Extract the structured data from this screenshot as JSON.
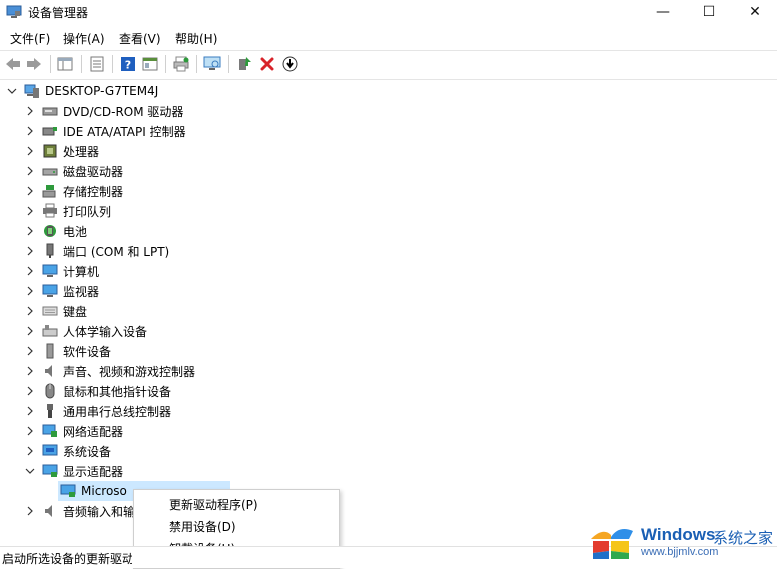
{
  "window": {
    "title": "设备管理器",
    "minimize_glyph": "—",
    "maximize_glyph": "☐",
    "close_glyph": "✕"
  },
  "menu": [
    "文件(F)",
    "操作(A)",
    "查看(V)",
    "帮助(H)"
  ],
  "toolbar": {
    "icons": [
      "back-arrow-icon",
      "forward-arrow-icon",
      "properties-grid-icon",
      "list-view-icon",
      "help-icon",
      "details-panel-icon",
      "print-icon",
      "monitor-scan-icon",
      "update-driver-icon",
      "uninstall-x-icon",
      "download-circle-icon"
    ],
    "colors": {
      "help_blue": "#1f5fbf",
      "x_red": "#d8232a",
      "green": "#2e9a3c"
    }
  },
  "tree": {
    "root": "DESKTOP-G7TEM4J",
    "categories": [
      {
        "label": "DVD/CD-ROM 驱动器",
        "icon": "dvd-drive-icon",
        "expanded": false
      },
      {
        "label": "IDE ATA/ATAPI 控制器",
        "icon": "ide-controller-icon",
        "expanded": false
      },
      {
        "label": "处理器",
        "icon": "processor-icon",
        "expanded": false
      },
      {
        "label": "磁盘驱动器",
        "icon": "disk-drive-icon",
        "expanded": false
      },
      {
        "label": "存储控制器",
        "icon": "storage-controller-icon",
        "expanded": false
      },
      {
        "label": "打印队列",
        "icon": "printer-icon",
        "expanded": false
      },
      {
        "label": "电池",
        "icon": "battery-icon",
        "expanded": false
      },
      {
        "label": "端口 (COM 和 LPT)",
        "icon": "port-icon",
        "expanded": false
      },
      {
        "label": "计算机",
        "icon": "computer-icon",
        "expanded": false
      },
      {
        "label": "监视器",
        "icon": "monitor-icon",
        "expanded": false
      },
      {
        "label": "键盘",
        "icon": "keyboard-icon",
        "expanded": false
      },
      {
        "label": "人体学输入设备",
        "icon": "hid-icon",
        "expanded": false
      },
      {
        "label": "软件设备",
        "icon": "software-device-icon",
        "expanded": false
      },
      {
        "label": "声音、视频和游戏控制器",
        "icon": "speaker-icon",
        "expanded": false
      },
      {
        "label": "鼠标和其他指针设备",
        "icon": "mouse-icon",
        "expanded": false
      },
      {
        "label": "通用串行总线控制器",
        "icon": "usb-icon",
        "expanded": false
      },
      {
        "label": "网络适配器",
        "icon": "network-adapter-icon",
        "expanded": false
      },
      {
        "label": "系统设备",
        "icon": "system-device-icon",
        "expanded": false
      },
      {
        "label": "显示适配器",
        "icon": "display-adapter-icon",
        "expanded": true
      },
      {
        "label": "音频输入和输",
        "icon": "audio-io-icon",
        "expanded": false
      }
    ],
    "display_child": "Microso"
  },
  "context_menu": [
    "更新驱动程序(P)",
    "禁用设备(D)",
    "卸载设备(U)"
  ],
  "status": "启动所选设备的更新驱动",
  "watermark": {
    "brand": "Windows",
    "cn": "系统之家",
    "url": "www.bjjmlv.com"
  }
}
